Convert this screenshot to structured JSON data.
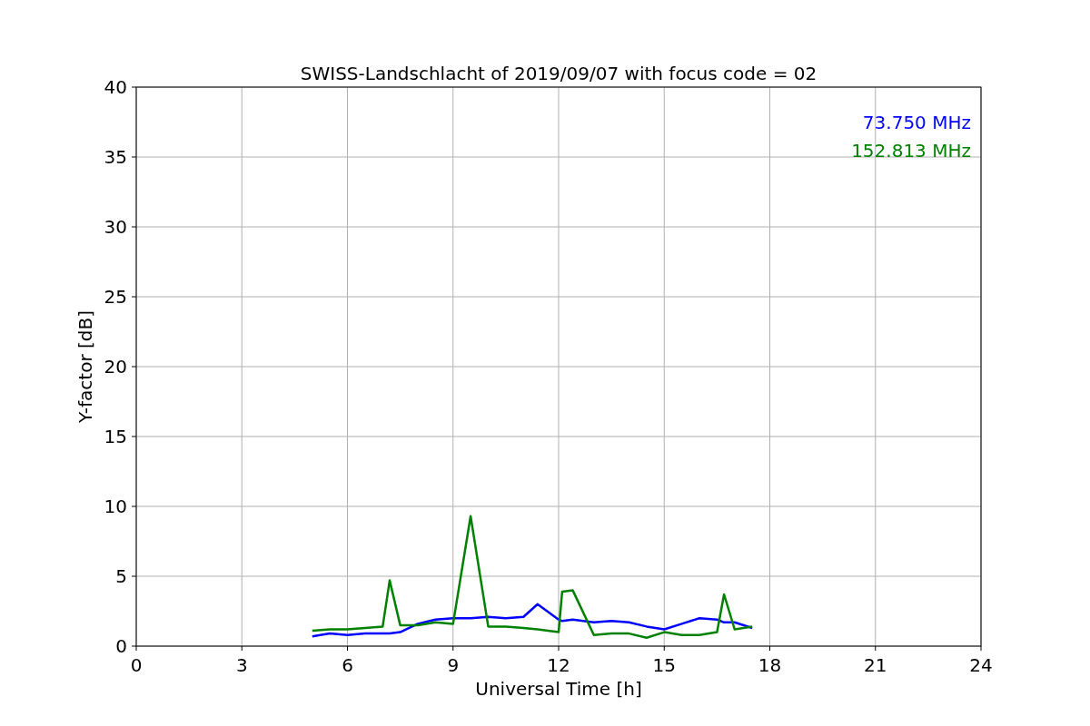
{
  "chart_data": {
    "type": "line",
    "title": "SWISS-Landschlacht of 2019/09/07 with focus code = 02",
    "xlabel": "Universal Time [h]",
    "ylabel": "Y-factor [dB]",
    "x": [
      5,
      5.5,
      6,
      6.5,
      7,
      7.2,
      7.5,
      8,
      8.5,
      9,
      9.5,
      10,
      10.5,
      11,
      11.4,
      12,
      12.1,
      12.4,
      13,
      13.5,
      14,
      14.5,
      15,
      15.5,
      16,
      16.5,
      16.7,
      17,
      17.5
    ],
    "series": [
      {
        "name": "73.750 MHz",
        "color": "#0000ff",
        "values": [
          0.7,
          0.9,
          0.8,
          0.9,
          0.9,
          0.9,
          1.0,
          1.6,
          1.9,
          2.0,
          2.0,
          2.1,
          2.0,
          2.1,
          3.0,
          1.9,
          1.8,
          1.9,
          1.7,
          1.8,
          1.7,
          1.4,
          1.2,
          1.6,
          2.0,
          1.9,
          1.7,
          1.7,
          1.3
        ]
      },
      {
        "name": "152.813 MHz",
        "color": "#008000",
        "values": [
          1.1,
          1.2,
          1.2,
          1.3,
          1.4,
          4.7,
          1.5,
          1.5,
          1.7,
          1.6,
          9.3,
          1.4,
          1.4,
          1.3,
          1.2,
          1.0,
          3.9,
          4.0,
          0.8,
          0.9,
          0.9,
          0.6,
          1.0,
          0.8,
          0.8,
          1.0,
          3.7,
          1.2,
          1.4
        ]
      }
    ],
    "xlim": [
      0,
      24
    ],
    "ylim": [
      0,
      40
    ],
    "xticks": [
      0,
      3,
      6,
      9,
      12,
      15,
      18,
      21,
      24
    ],
    "yticks": [
      0,
      5,
      10,
      15,
      20,
      25,
      30,
      35,
      40
    ],
    "grid": true
  }
}
